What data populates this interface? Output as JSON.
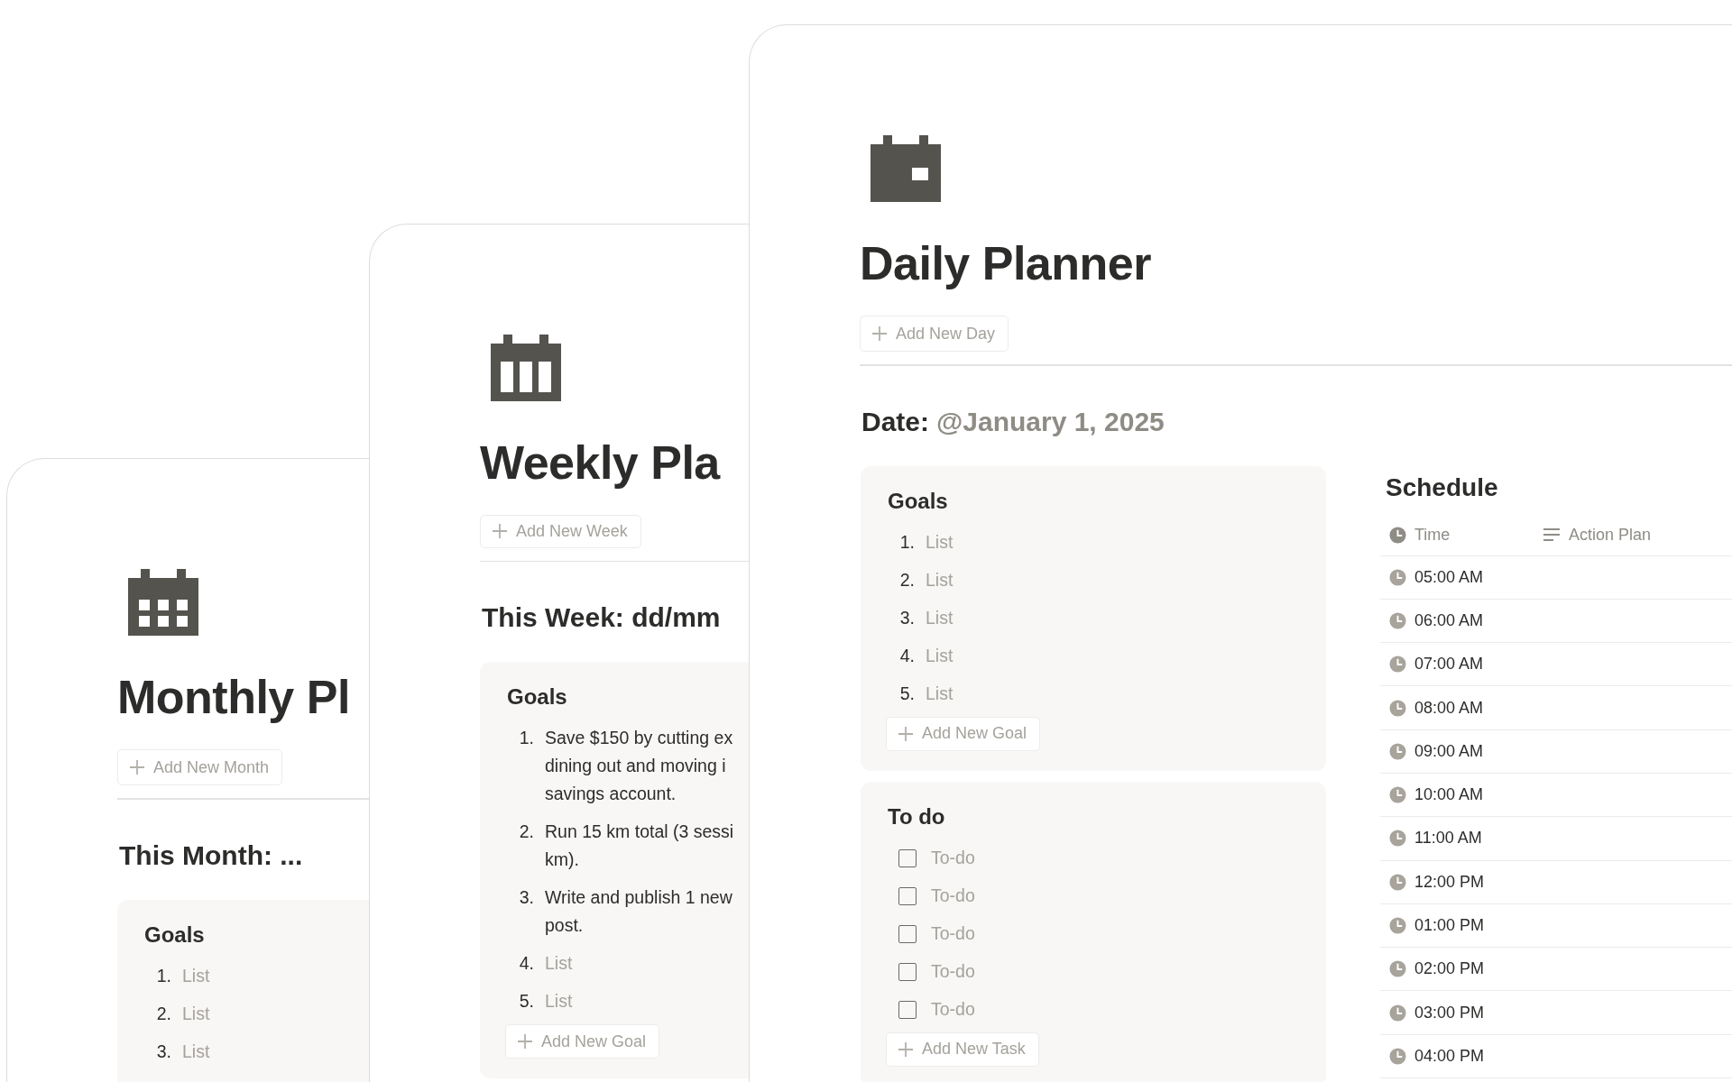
{
  "pages": [
    {
      "kind": "monthly",
      "title": "Monthly Pl",
      "add_button": "Add New Month",
      "heading": "This Month: ...",
      "goals": {
        "title": "Goals",
        "items": [
          {
            "number": "1.",
            "lines": [
              "List"
            ],
            "placeholder": true
          },
          {
            "number": "2.",
            "lines": [
              "List"
            ],
            "placeholder": true
          },
          {
            "number": "3.",
            "lines": [
              "List"
            ],
            "placeholder": true
          }
        ]
      }
    },
    {
      "kind": "weekly",
      "title": "Weekly Pla",
      "add_button": "Add New Week",
      "heading": "This Week: dd/mm",
      "goals": {
        "title": "Goals",
        "items": [
          {
            "number": "1.",
            "lines": [
              "Save $150 by cutting ex",
              "dining out and moving i",
              "savings account."
            ],
            "placeholder": false
          },
          {
            "number": "2.",
            "lines": [
              "Run 15 km total (3 sessi",
              "km)."
            ],
            "placeholder": false
          },
          {
            "number": "3.",
            "lines": [
              "Write and publish 1 new",
              "post."
            ],
            "placeholder": false
          },
          {
            "number": "4.",
            "lines": [
              "List"
            ],
            "placeholder": true
          },
          {
            "number": "5.",
            "lines": [
              "List"
            ],
            "placeholder": true
          }
        ],
        "add_button": "Add New Goal"
      }
    },
    {
      "kind": "daily",
      "title": "Daily Planner",
      "add_button": "Add New Day",
      "date_label": "Date:",
      "date_value": "@January 1, 2025",
      "goals": {
        "title": "Goals",
        "items": [
          {
            "number": "1.",
            "lines": [
              "List"
            ],
            "placeholder": true
          },
          {
            "number": "2.",
            "lines": [
              "List"
            ],
            "placeholder": true
          },
          {
            "number": "3.",
            "lines": [
              "List"
            ],
            "placeholder": true
          },
          {
            "number": "4.",
            "lines": [
              "List"
            ],
            "placeholder": true
          },
          {
            "number": "5.",
            "lines": [
              "List"
            ],
            "placeholder": true
          }
        ],
        "add_button": "Add New Goal"
      },
      "todo": {
        "title": "To do",
        "items": [
          {
            "text": "To-do",
            "checked": false
          },
          {
            "text": "To-do",
            "checked": false
          },
          {
            "text": "To-do",
            "checked": false
          },
          {
            "text": "To-do",
            "checked": false
          },
          {
            "text": "To-do",
            "checked": false
          }
        ],
        "add_button": "Add New Task"
      },
      "schedule": {
        "title": "Schedule",
        "columns": [
          "Time",
          "Action Plan"
        ],
        "rows": [
          "05:00 AM",
          "06:00 AM",
          "07:00 AM",
          "08:00 AM",
          "09:00 AM",
          "10:00 AM",
          "11:00 AM",
          "12:00 PM",
          "01:00 PM",
          "02:00 PM",
          "03:00 PM",
          "04:00 PM"
        ]
      }
    }
  ]
}
